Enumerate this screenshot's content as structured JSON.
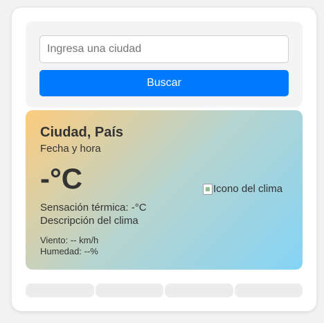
{
  "search": {
    "placeholder": "Ingresa una ciudad",
    "value": "",
    "button_label": "Buscar"
  },
  "weather": {
    "city": "Ciudad, País",
    "datetime": "Fecha y hora",
    "temperature": "-°C",
    "feels_like": "Sensación térmica: -°C",
    "description": "Descripción del clima",
    "wind": "Viento: -- km/h",
    "humidity": "Humedad: --%",
    "icon_alt": "Icono del clima"
  },
  "forecast": {
    "count": 4
  },
  "colors": {
    "accent": "#007bff",
    "gradient_start": "#fccb7e",
    "gradient_end": "#84d4f6"
  }
}
